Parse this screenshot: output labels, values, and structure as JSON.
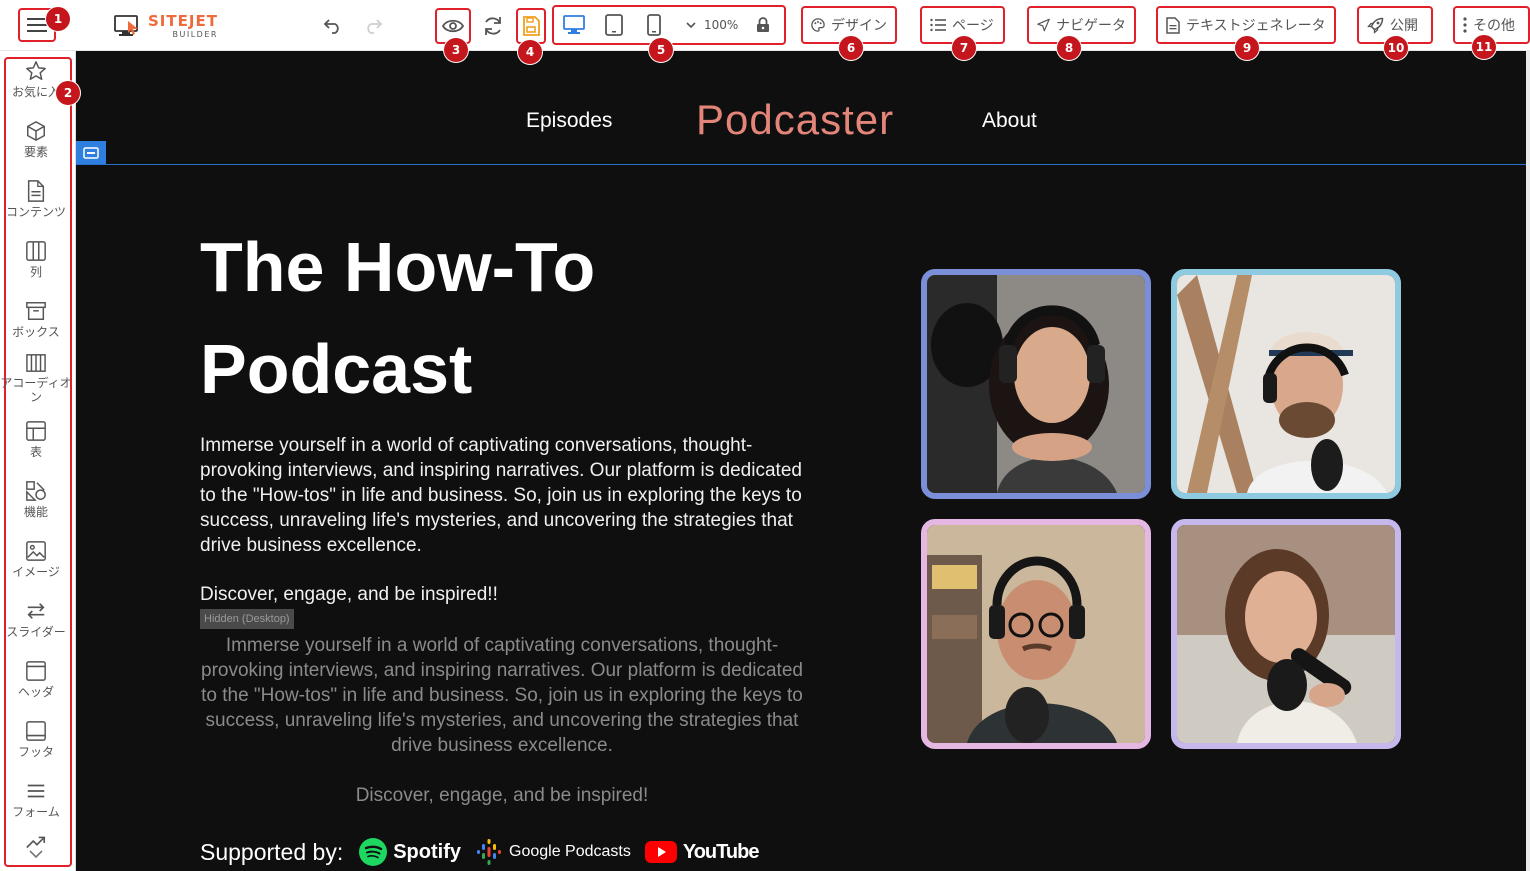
{
  "app": {
    "logo_main": "SITEJET",
    "logo_sub": "BUILDER"
  },
  "toolbar": {
    "zoom": "100%",
    "design_label": "デザイン",
    "pages_label": "ページ",
    "navigator_label": "ナビゲータ",
    "textgen_label": "テキストジェネレータ",
    "publish_label": "公開",
    "more_label": "その他"
  },
  "badges": [
    "1",
    "2",
    "3",
    "4",
    "5",
    "6",
    "7",
    "8",
    "9",
    "10",
    "11"
  ],
  "sidebar": {
    "items": [
      {
        "label": "お気に入",
        "icon": "star-icon"
      },
      {
        "label": "要素",
        "icon": "cube-icon"
      },
      {
        "label": "コンテンツ",
        "icon": "document-icon"
      },
      {
        "label": "列",
        "icon": "columns-icon"
      },
      {
        "label": "ボックス",
        "icon": "box-icon"
      },
      {
        "label": "アコーディオン",
        "icon": "accordion-icon"
      },
      {
        "label": "表",
        "icon": "table-icon"
      },
      {
        "label": "機能",
        "icon": "shapes-icon"
      },
      {
        "label": "イメージ",
        "icon": "image-icon"
      },
      {
        "label": "スライダー",
        "icon": "slider-icon"
      },
      {
        "label": "ヘッダ",
        "icon": "header-icon"
      },
      {
        "label": "フッタ",
        "icon": "footer-icon"
      },
      {
        "label": "フォーム",
        "icon": "form-icon"
      }
    ]
  },
  "site": {
    "nav": {
      "episodes": "Episodes",
      "brand": "Podcaster",
      "about": "About"
    },
    "hero": {
      "title": "The How-To Podcast",
      "text": "Immerse yourself in a world of captivating conversations, thought-provoking interviews, and inspiring narratives. Our platform is dedicated to the \"How-tos\" in life and business. So, join us in exploring the keys to success, unraveling life's mysteries, and uncovering the strategies that drive business excellence.",
      "cta": "Discover, engage, and be inspired!!",
      "hidden_badge": "Hidden (Desktop)",
      "hidden_text": "Immerse yourself in a world of captivating conversations, thought-provoking interviews, and inspiring narratives. Our platform is dedicated to the \"How-tos\" in life and business. So, join us in exploring the keys to success, unraveling life's mysteries, and uncovering the strategies that drive business excellence.",
      "hidden_cta": "Discover, engage, and be inspired!"
    },
    "supported": {
      "label": "Supported by:",
      "spotify": "Spotify",
      "google": "Google Podcasts",
      "youtube": "YouTube"
    },
    "photo_borders": [
      "#7b8fd8",
      "#8fcbe0",
      "#e5b7e3",
      "#c6b7ec"
    ]
  },
  "colors": {
    "accent_red": "#e0202a",
    "badge_red": "#c4161c",
    "brand_orange": "#ef6a3a",
    "save_orange": "#f0a020",
    "device_blue": "#2f7fe0",
    "podcaster_pink": "#e4857a"
  }
}
